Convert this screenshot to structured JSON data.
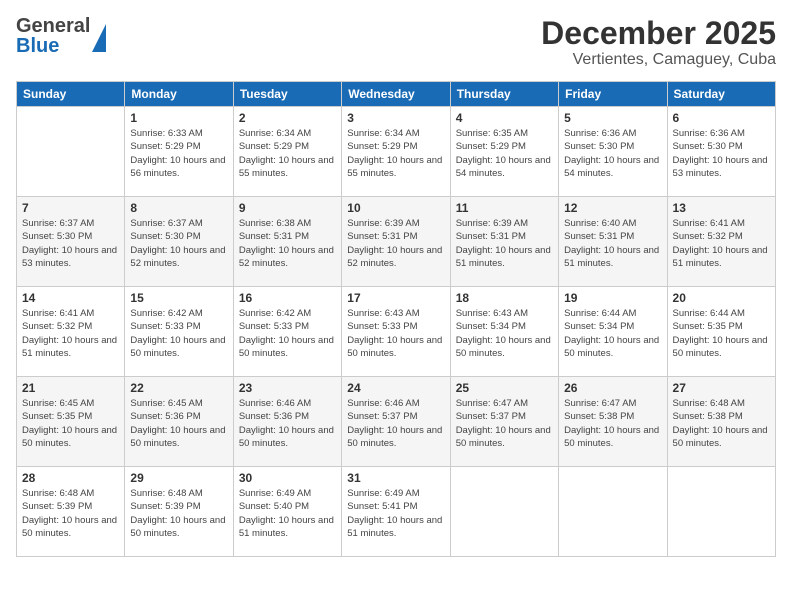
{
  "header": {
    "logo_general": "General",
    "logo_blue": "Blue",
    "title": "December 2025",
    "subtitle": "Vertientes, Camaguey, Cuba"
  },
  "calendar": {
    "days": [
      "Sunday",
      "Monday",
      "Tuesday",
      "Wednesday",
      "Thursday",
      "Friday",
      "Saturday"
    ],
    "rows": [
      [
        {
          "num": "",
          "detail": ""
        },
        {
          "num": "1",
          "detail": "Sunrise: 6:33 AM\nSunset: 5:29 PM\nDaylight: 10 hours\nand 56 minutes."
        },
        {
          "num": "2",
          "detail": "Sunrise: 6:34 AM\nSunset: 5:29 PM\nDaylight: 10 hours\nand 55 minutes."
        },
        {
          "num": "3",
          "detail": "Sunrise: 6:34 AM\nSunset: 5:29 PM\nDaylight: 10 hours\nand 55 minutes."
        },
        {
          "num": "4",
          "detail": "Sunrise: 6:35 AM\nSunset: 5:29 PM\nDaylight: 10 hours\nand 54 minutes."
        },
        {
          "num": "5",
          "detail": "Sunrise: 6:36 AM\nSunset: 5:30 PM\nDaylight: 10 hours\nand 54 minutes."
        },
        {
          "num": "6",
          "detail": "Sunrise: 6:36 AM\nSunset: 5:30 PM\nDaylight: 10 hours\nand 53 minutes."
        }
      ],
      [
        {
          "num": "7",
          "detail": "Sunrise: 6:37 AM\nSunset: 5:30 PM\nDaylight: 10 hours\nand 53 minutes."
        },
        {
          "num": "8",
          "detail": "Sunrise: 6:37 AM\nSunset: 5:30 PM\nDaylight: 10 hours\nand 52 minutes."
        },
        {
          "num": "9",
          "detail": "Sunrise: 6:38 AM\nSunset: 5:31 PM\nDaylight: 10 hours\nand 52 minutes."
        },
        {
          "num": "10",
          "detail": "Sunrise: 6:39 AM\nSunset: 5:31 PM\nDaylight: 10 hours\nand 52 minutes."
        },
        {
          "num": "11",
          "detail": "Sunrise: 6:39 AM\nSunset: 5:31 PM\nDaylight: 10 hours\nand 51 minutes."
        },
        {
          "num": "12",
          "detail": "Sunrise: 6:40 AM\nSunset: 5:31 PM\nDaylight: 10 hours\nand 51 minutes."
        },
        {
          "num": "13",
          "detail": "Sunrise: 6:41 AM\nSunset: 5:32 PM\nDaylight: 10 hours\nand 51 minutes."
        }
      ],
      [
        {
          "num": "14",
          "detail": "Sunrise: 6:41 AM\nSunset: 5:32 PM\nDaylight: 10 hours\nand 51 minutes."
        },
        {
          "num": "15",
          "detail": "Sunrise: 6:42 AM\nSunset: 5:33 PM\nDaylight: 10 hours\nand 50 minutes."
        },
        {
          "num": "16",
          "detail": "Sunrise: 6:42 AM\nSunset: 5:33 PM\nDaylight: 10 hours\nand 50 minutes."
        },
        {
          "num": "17",
          "detail": "Sunrise: 6:43 AM\nSunset: 5:33 PM\nDaylight: 10 hours\nand 50 minutes."
        },
        {
          "num": "18",
          "detail": "Sunrise: 6:43 AM\nSunset: 5:34 PM\nDaylight: 10 hours\nand 50 minutes."
        },
        {
          "num": "19",
          "detail": "Sunrise: 6:44 AM\nSunset: 5:34 PM\nDaylight: 10 hours\nand 50 minutes."
        },
        {
          "num": "20",
          "detail": "Sunrise: 6:44 AM\nSunset: 5:35 PM\nDaylight: 10 hours\nand 50 minutes."
        }
      ],
      [
        {
          "num": "21",
          "detail": "Sunrise: 6:45 AM\nSunset: 5:35 PM\nDaylight: 10 hours\nand 50 minutes."
        },
        {
          "num": "22",
          "detail": "Sunrise: 6:45 AM\nSunset: 5:36 PM\nDaylight: 10 hours\nand 50 minutes."
        },
        {
          "num": "23",
          "detail": "Sunrise: 6:46 AM\nSunset: 5:36 PM\nDaylight: 10 hours\nand 50 minutes."
        },
        {
          "num": "24",
          "detail": "Sunrise: 6:46 AM\nSunset: 5:37 PM\nDaylight: 10 hours\nand 50 minutes."
        },
        {
          "num": "25",
          "detail": "Sunrise: 6:47 AM\nSunset: 5:37 PM\nDaylight: 10 hours\nand 50 minutes."
        },
        {
          "num": "26",
          "detail": "Sunrise: 6:47 AM\nSunset: 5:38 PM\nDaylight: 10 hours\nand 50 minutes."
        },
        {
          "num": "27",
          "detail": "Sunrise: 6:48 AM\nSunset: 5:38 PM\nDaylight: 10 hours\nand 50 minutes."
        }
      ],
      [
        {
          "num": "28",
          "detail": "Sunrise: 6:48 AM\nSunset: 5:39 PM\nDaylight: 10 hours\nand 50 minutes."
        },
        {
          "num": "29",
          "detail": "Sunrise: 6:48 AM\nSunset: 5:39 PM\nDaylight: 10 hours\nand 50 minutes."
        },
        {
          "num": "30",
          "detail": "Sunrise: 6:49 AM\nSunset: 5:40 PM\nDaylight: 10 hours\nand 51 minutes."
        },
        {
          "num": "31",
          "detail": "Sunrise: 6:49 AM\nSunset: 5:41 PM\nDaylight: 10 hours\nand 51 minutes."
        },
        {
          "num": "",
          "detail": ""
        },
        {
          "num": "",
          "detail": ""
        },
        {
          "num": "",
          "detail": ""
        }
      ]
    ]
  }
}
